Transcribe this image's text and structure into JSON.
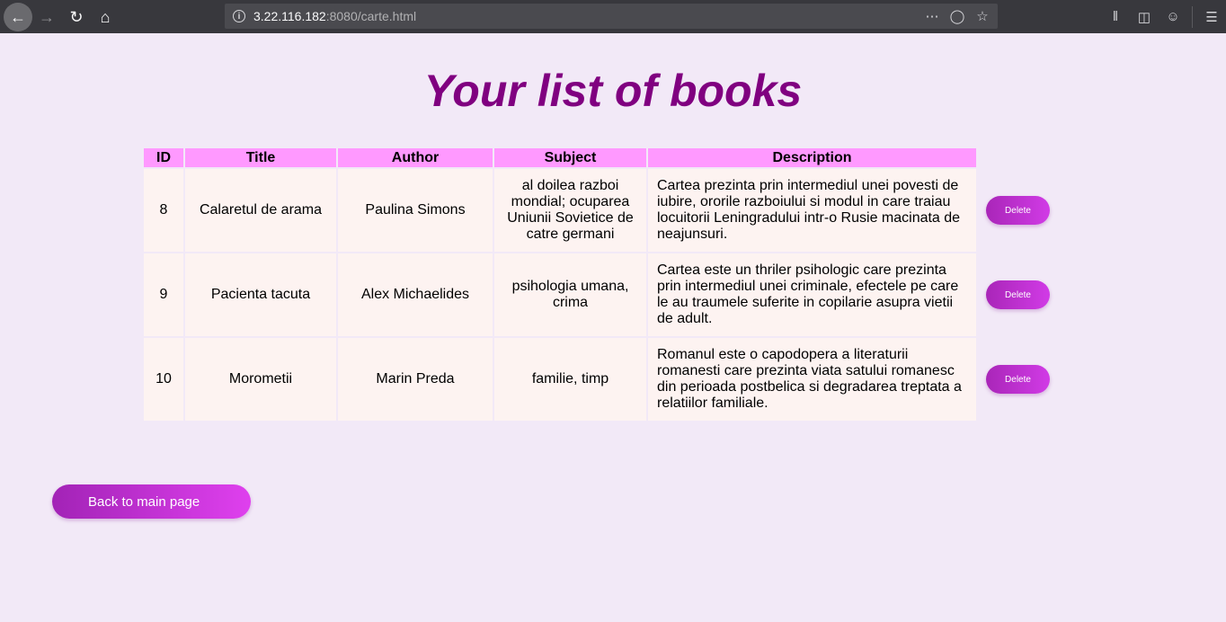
{
  "browser": {
    "url_host": "3.22.116.182",
    "url_rest": ":8080/carte.html"
  },
  "page": {
    "title": "Your list of books"
  },
  "table": {
    "headers": [
      "ID",
      "Title",
      "Author",
      "Subject",
      "Description"
    ],
    "rows": [
      {
        "id": "8",
        "title": "Calaretul de arama",
        "author": "Paulina Simons",
        "subject": "al doilea razboi mondial; ocuparea Uniunii Sovietice de catre germani",
        "description": "Cartea prezinta prin intermediul unei povesti de iubire, ororile razboiului si modul in care traiau locuitorii Leningradului intr-o Rusie macinata de neajunsuri.",
        "action": "Delete"
      },
      {
        "id": "9",
        "title": "Pacienta tacuta",
        "author": "Alex Michaelides",
        "subject": "psihologia umana, crima",
        "description": "Cartea este un thriler psihologic care prezinta prin intermediul unei criminale, efectele pe care le au traumele suferite in copilarie asupra vietii de adult.",
        "action": "Delete"
      },
      {
        "id": "10",
        "title": "Morometii",
        "author": "Marin Preda",
        "subject": "familie, timp",
        "description": "Romanul este o capodopera a literaturii romanesti care prezinta viata satului romanesc din perioada postbelica si degradarea treptata a relatiilor familiale.",
        "action": "Delete"
      }
    ]
  },
  "back_button": {
    "label": "Back to main page"
  }
}
